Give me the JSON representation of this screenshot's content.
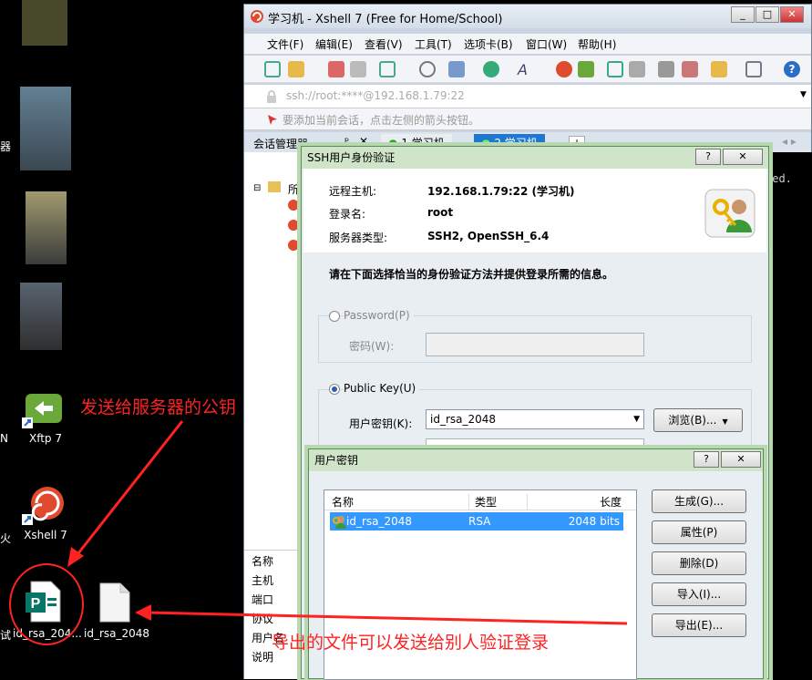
{
  "desktop": {
    "icons": [
      {
        "label": "Xftp 7"
      },
      {
        "label": "Xshell 7"
      },
      {
        "label": "id_rsa_204..."
      },
      {
        "label": "id_rsa_2048"
      }
    ],
    "edge_labels": [
      "器",
      "N",
      "火",
      "试"
    ]
  },
  "xshell": {
    "title": "学习机 - Xshell 7 (Free for Home/School)",
    "menu": [
      "文件(F)",
      "编辑(E)",
      "查看(V)",
      "工具(T)",
      "选项卡(B)",
      "窗口(W)",
      "帮助(H)"
    ],
    "address": "ssh://root:****@192.168.1.79:22",
    "hint": "要添加当前会话，点击左侧的箭头按钮。",
    "session_manager_label": "会话管理器",
    "tabs": [
      "1 学习机",
      "2 学习机"
    ],
    "tree_root": "所",
    "props": [
      "名称",
      "主机",
      "端口",
      "协议",
      "用户名",
      "说明"
    ],
    "terminal_text": "ved."
  },
  "auth_dialog": {
    "title": "SSH用户身份验证",
    "remote_host_label": "远程主机:",
    "remote_host_value": "192.168.1.79:22 (学习机)",
    "login_label": "登录名:",
    "login_value": "root",
    "server_type_label": "服务器类型:",
    "server_type_value": "SSH2, OpenSSH_6.4",
    "instruction": "请在下面选择恰当的身份验证方法并提供登录所需的信息。",
    "password_option": "Password(P)",
    "password_field_label": "密码(W):",
    "publickey_option": "Public Key(U)",
    "user_key_label": "用户密钥(K):",
    "user_key_value": "id_rsa_2048",
    "browse_button": "浏览(B)...",
    "help_button": "?",
    "close_button": "✕"
  },
  "key_dialog": {
    "title": "用户密钥",
    "columns": [
      "名称",
      "类型",
      "长度"
    ],
    "rows": [
      {
        "name": "id_rsa_2048",
        "type": "RSA",
        "length": "2048 bits"
      }
    ],
    "buttons": [
      "生成(G)...",
      "属性(P)",
      "删除(D)",
      "导入(I)...",
      "导出(E)..."
    ],
    "help_button": "?",
    "close_button": "✕"
  },
  "annotations": {
    "public_key_note": "发送给服务器的公钥",
    "exported_note": "导出的文件可以发送给别人验证登录"
  },
  "colors": {
    "annotation": "#ff2222",
    "selection": "#3399ff",
    "dialog_frame": "#b8d8b0"
  }
}
